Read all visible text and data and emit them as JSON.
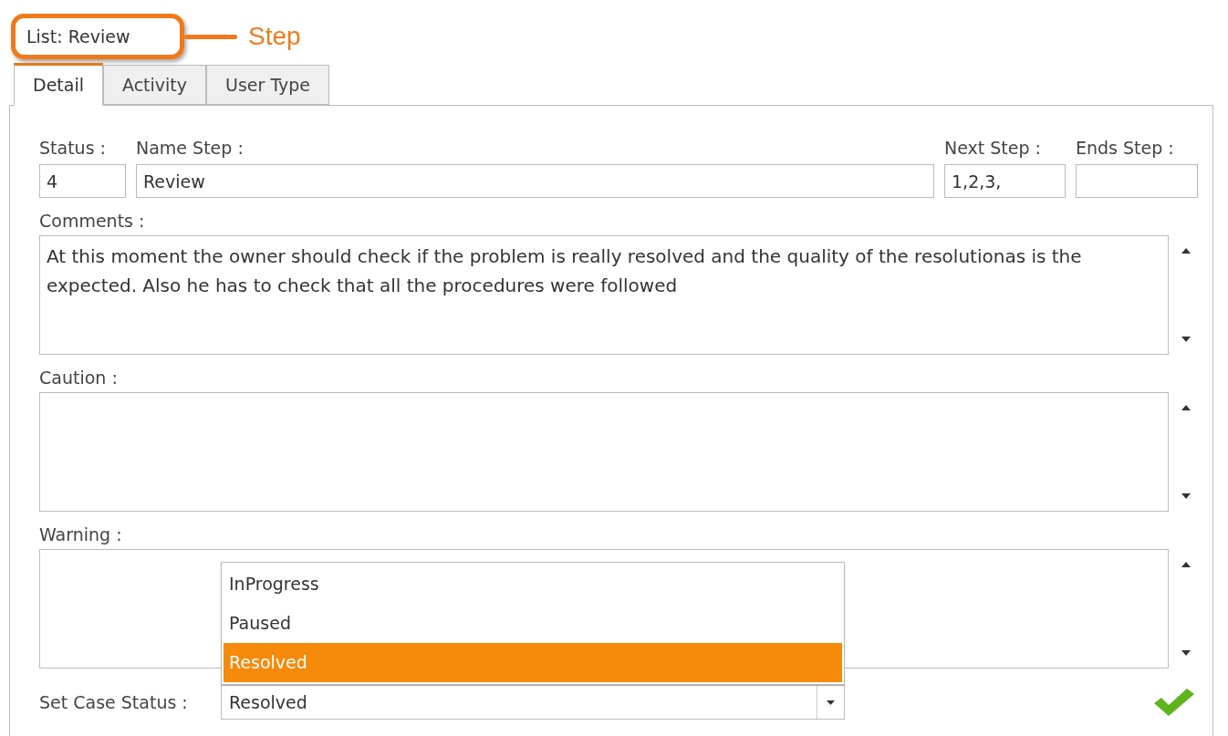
{
  "header": {
    "title": "List: Review",
    "callout": "Step"
  },
  "tabs": [
    {
      "label": "Detail",
      "selected": true
    },
    {
      "label": "Activity",
      "selected": false
    },
    {
      "label": "User Type",
      "selected": false
    }
  ],
  "fields": {
    "status": {
      "label": "Status :",
      "value": "4"
    },
    "name_step": {
      "label": "Name Step :",
      "value": "Review"
    },
    "next_step": {
      "label": "Next Step :",
      "value": "1,2,3,"
    },
    "ends_step": {
      "label": "Ends Step :"
    }
  },
  "text_areas": [
    {
      "label": "Comments :",
      "value": "At this moment the owner should check if the problem is really resolved and the quality of the resolutionas is the expected. Also he has to check that all the procedures were followed"
    },
    {
      "label": "Caution :"
    },
    {
      "label": "Warning :"
    }
  ],
  "case_status": {
    "label": "Set Case Status :",
    "value": "Resolved",
    "expanded": true,
    "options": [
      {
        "label": "InProgress",
        "selected": false
      },
      {
        "label": "Paused",
        "selected": false
      },
      {
        "label": "Resolved",
        "selected": true
      }
    ]
  }
}
